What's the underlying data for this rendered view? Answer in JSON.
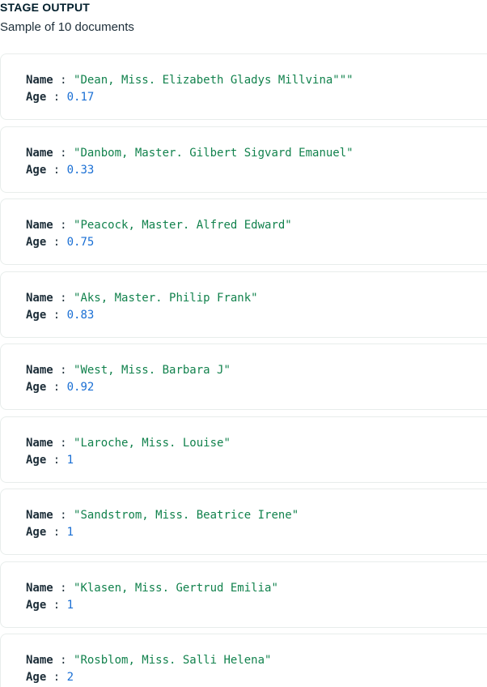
{
  "header": {
    "title": "STAGE OUTPUT",
    "subtitle": "Sample of 10 documents"
  },
  "field_keys": {
    "name": "Name",
    "age": "Age",
    "separator": " : "
  },
  "documents": [
    {
      "name": "\"Dean, Miss. Elizabeth Gladys Millvina\"\"\"",
      "age": "0.17"
    },
    {
      "name": "\"Danbom, Master. Gilbert Sigvard Emanuel\"",
      "age": "0.33"
    },
    {
      "name": "\"Peacock, Master. Alfred Edward\"",
      "age": "0.75"
    },
    {
      "name": "\"Aks, Master. Philip Frank\"",
      "age": "0.83"
    },
    {
      "name": "\"West, Miss. Barbara J\"",
      "age": "0.92"
    },
    {
      "name": "\"Laroche, Miss. Louise\"",
      "age": "1"
    },
    {
      "name": "\"Sandstrom, Miss. Beatrice Irene\"",
      "age": "1"
    },
    {
      "name": "\"Klasen, Miss. Gertrud Emilia\"",
      "age": "1"
    },
    {
      "name": "\"Rosblom, Miss. Salli Helena\"",
      "age": "2"
    }
  ],
  "colors": {
    "string_value": "#12824d",
    "number_value": "#1a6fd4",
    "card_border": "#e8edeb"
  }
}
